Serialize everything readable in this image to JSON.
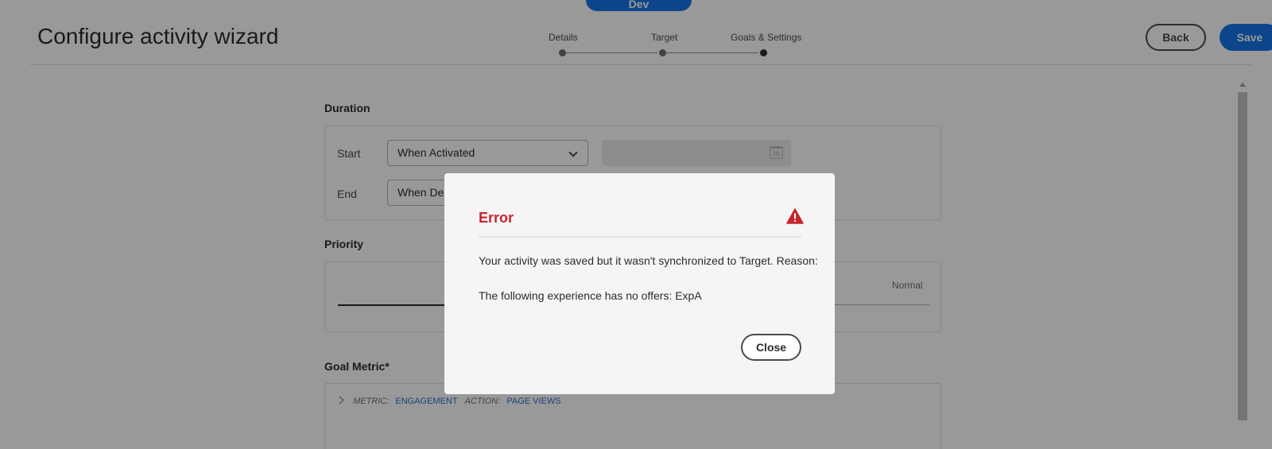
{
  "env_badge": "Dev",
  "header": {
    "title": "Configure activity wizard",
    "steps": [
      "Details",
      "Target",
      "Goals & Settings"
    ],
    "back_label": "Back",
    "save_label": "Save"
  },
  "duration": {
    "heading": "Duration",
    "start_label": "Start",
    "start_value": "When Activated",
    "end_label": "End",
    "end_value": "When Deactivated",
    "end_value_visible": "When Dea",
    "calendar_icon": "calendar-icon"
  },
  "priority": {
    "heading": "Priority",
    "value": "Normal"
  },
  "goal_metric": {
    "heading": "Goal Metric*",
    "metric_key": "METRIC:",
    "metric_value": "ENGAGEMENT",
    "action_key": "ACTION:",
    "action_value": "PAGE VIEWS"
  },
  "modal": {
    "title": "Error",
    "title_color": "#c9252d",
    "icon": "alert-triangle-icon",
    "message": "Your activity was saved but it wasn't synchronized to Target. Reason:",
    "reason": "The following experience has no offers: ExpA",
    "close_label": "Close"
  },
  "colors": {
    "accent": "#1473e6",
    "error": "#c9252d",
    "link": "#2c6ecb"
  }
}
